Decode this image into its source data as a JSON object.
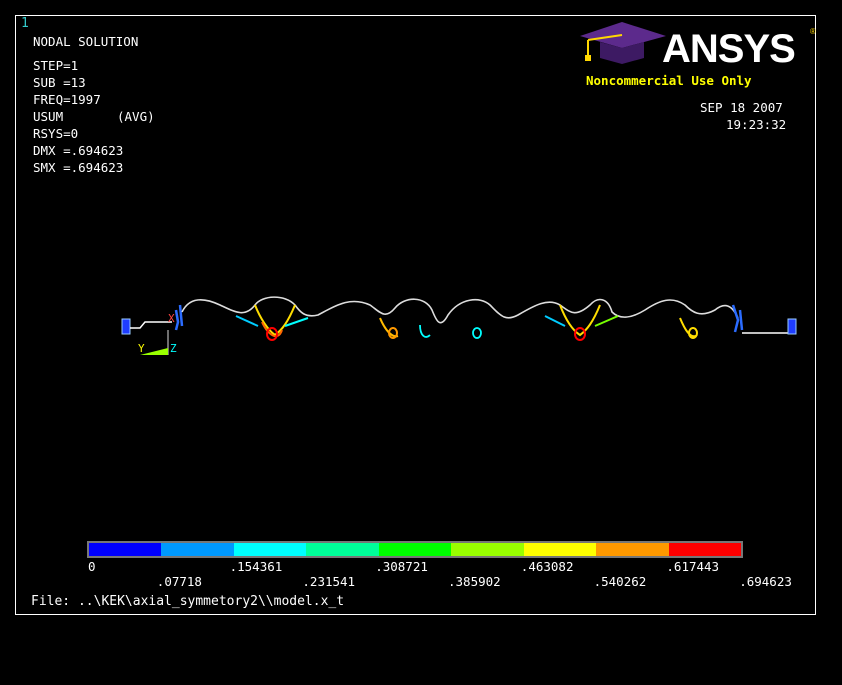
{
  "window_number": "1",
  "info": {
    "title": "NODAL SOLUTION",
    "step": "STEP=1",
    "sub": "SUB =13",
    "freq": "FREQ=1997",
    "usum": "USUM",
    "avg": "(AVG)",
    "rsys": "RSYS=0",
    "dmx": "DMX =.694623",
    "smx": "SMX =.694623"
  },
  "logo": {
    "text": "ANSYS",
    "tagline": "Noncommercial Use Only"
  },
  "datetime": {
    "date": "SEP 18 2007",
    "time": "19:23:32"
  },
  "triad": {
    "y": "Y",
    "z": "Z",
    "x": "X"
  },
  "legend": {
    "colors": [
      "#0000ff",
      "#0099ff",
      "#00ffff",
      "#00ff99",
      "#00ff00",
      "#99ff00",
      "#ffff00",
      "#ff9900",
      "#ff0000"
    ],
    "labels_top": [
      "0",
      ".154361",
      ".308721",
      ".463082",
      ".617443"
    ],
    "labels_bottom": [
      ".07718",
      ".231541",
      ".385902",
      ".540262",
      ".694623"
    ]
  },
  "file": "File: ..\\KEK\\axial_symmetory2\\\\model.x_t"
}
